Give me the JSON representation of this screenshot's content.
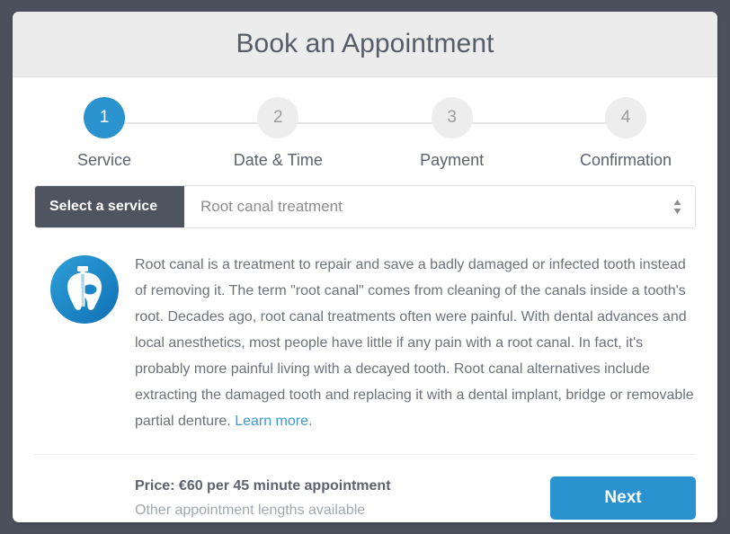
{
  "header": {
    "title": "Book an Appointment"
  },
  "stepper": {
    "active_index": 0,
    "steps": [
      {
        "number": "1",
        "label": "Service"
      },
      {
        "number": "2",
        "label": "Date & Time"
      },
      {
        "number": "3",
        "label": "Payment"
      },
      {
        "number": "4",
        "label": "Confirmation"
      }
    ]
  },
  "service_selector": {
    "label": "Select a service",
    "selected_value": "Root canal treatment",
    "dropdown_icon": "up-down-arrows-icon"
  },
  "service_details": {
    "icon_name": "tooth-root-canal-icon",
    "description": "Root canal is a treatment to repair and save a badly damaged or infected tooth instead of removing it. The term \"root canal\" comes from cleaning of the canals inside a tooth's root. Decades ago, root canal treatments often were painful. With dental advances and local anesthetics, most people have little if any pain with a root canal. In fact, it's probably more painful living with a decayed tooth. Root canal alternatives include extracting the damaged tooth and replacing it with a dental implant, bridge or removable partial denture. ",
    "learn_more_label": "Learn more."
  },
  "footer": {
    "price": "Price: €60 per 45 minute appointment",
    "price_note": "Other appointment lengths available",
    "next_label": "Next"
  },
  "colors": {
    "accent_blue": "#2a93cf",
    "link_blue": "#3a9ad4",
    "dark_slate": "#4f5461",
    "page_background": "#4c505c",
    "header_background": "#ececec"
  }
}
